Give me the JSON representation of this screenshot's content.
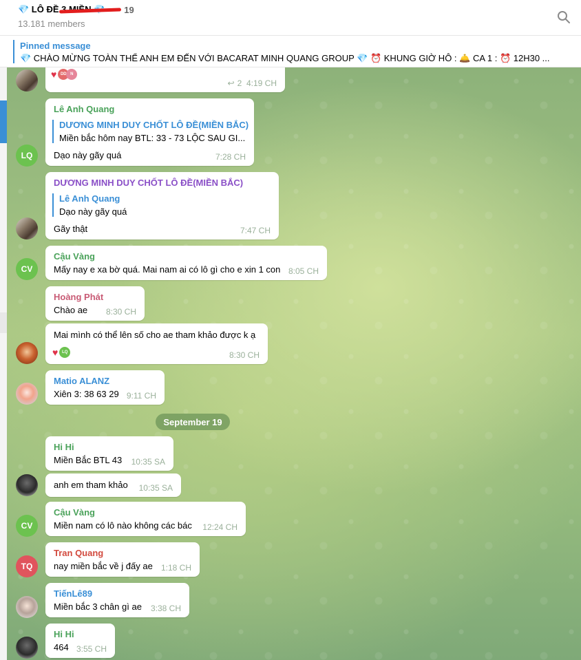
{
  "header": {
    "title_prefix": "💎 LÔ ĐỀ 3 MIỀN 💎 ",
    "title_suffix": "19",
    "members": "13.181 members"
  },
  "pinned": {
    "label": "Pinned message",
    "text": "💎 CHÀO MỪNG TOÀN THỂ ANH EM ĐẾN VỚI BACARAT MINH QUANG GROUP 💎  ⏰ KHUNG GIỜ HÔ :   🛎️ CA 1 :   ⏰ 12H30 ..."
  },
  "colors": {
    "accent": "#3a8fd6",
    "sender_green": "#4aa25a",
    "sender_purple": "#8a4fc7",
    "sender_pink": "#c85a74",
    "sender_blue": "#3a8fd6",
    "sender_red": "#d24a3e"
  },
  "date_separator": "September 19",
  "messages": [
    {
      "reply_count": "2",
      "time": "4:19 CH",
      "reaction_heart": "♥",
      "reaction_initials": [
        "DD",
        "N"
      ]
    },
    {
      "sender": "Lê Anh Quang",
      "avatar": "LQ",
      "reply_to": "DƯƠNG MINH DUY CHỐT LÔ ĐỀ(MIỀN BẮC)",
      "reply_text": "Miền bắc hôm nay BTL: 33 - 73 LỘC SAU GI...",
      "text": "Dạo này gãy quá",
      "time": "7:28 CH"
    },
    {
      "sender": "DƯƠNG MINH DUY CHỐT LÔ ĐỀ(MIỀN BẮC)",
      "reply_to": "Lê Anh Quang",
      "reply_text": "Dạo này gãy quá",
      "text": "Gãy thật",
      "time": "7:47 CH"
    },
    {
      "sender": "Cậu Vàng",
      "avatar": "CV",
      "text": "Mấy nay e xa bờ quá. Mai nam ai có lô gì cho e xin 1 con",
      "time": "8:05 CH"
    },
    {
      "sender": "Hoàng Phát",
      "text": "Chào ae",
      "time": "8:30 CH"
    },
    {
      "text": "Mai mình có thể lên số cho ae tham khảo được k ạ",
      "time": "8:30 CH",
      "reaction_heart": "♥",
      "reaction_initials": [
        "LQ"
      ]
    },
    {
      "sender": "Matio ALANZ",
      "text": "Xiên 3:  38 63 29",
      "time": "9:11 CH"
    },
    {
      "sender": "Hi Hi",
      "text": "Miền Bắc BTL 43",
      "time": "10:35 SA"
    },
    {
      "text": "anh em tham khảo",
      "time": "10:35 SA"
    },
    {
      "sender": "Cậu Vàng",
      "avatar": "CV",
      "text": "Miền nam có lô nào không các bác",
      "time": "12:24 CH"
    },
    {
      "sender": "Tran Quang",
      "avatar": "TQ",
      "text": "nay miền bắc về j đấy ae",
      "time": "1:18 CH"
    },
    {
      "sender": "TiếnLê89",
      "text": "Miền bắc 3 chân gì  ae",
      "time": "3:38 CH"
    },
    {
      "sender": "Hi Hi",
      "text": "464",
      "time": "3:55 CH"
    }
  ]
}
